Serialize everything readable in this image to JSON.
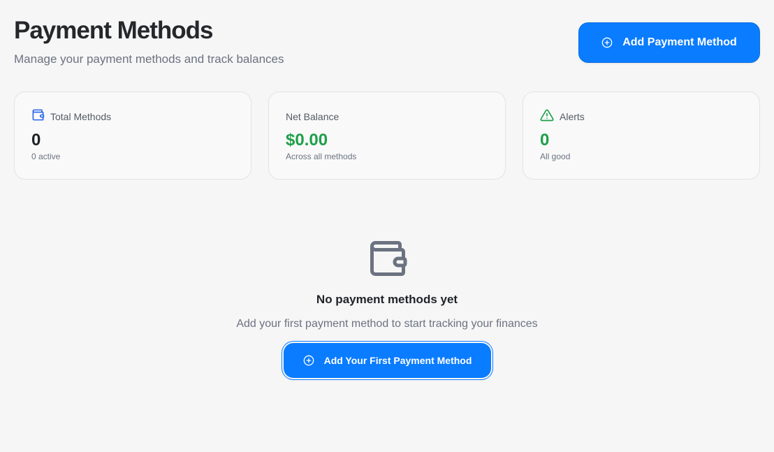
{
  "header": {
    "title": "Payment Methods",
    "subtitle": "Manage your payment methods and track balances",
    "add_button_label": "Add Payment Method"
  },
  "stats": [
    {
      "label": "Total Methods",
      "icon": "wallet-icon",
      "value": "0",
      "note": "0 active",
      "value_color": "#1f2227"
    },
    {
      "label": "Net Balance",
      "icon": "",
      "value": "$0.00",
      "note": "Across all methods",
      "value_color": "#1e9f4a"
    },
    {
      "label": "Alerts",
      "icon": "alert-triangle-icon",
      "value": "0",
      "note": "All good",
      "value_color": "#1e9f4a"
    }
  ],
  "empty_state": {
    "icon": "wallet-icon",
    "title": "No payment methods yet",
    "description": "Add your first payment method to start tracking your finances",
    "button_label": "Add Your First Payment Method"
  },
  "colors": {
    "primary": "#0a7cff",
    "success": "#1e9f4a",
    "wallet_icon": "#2563eb",
    "muted_text": "#6b7280",
    "background": "#f6f6f6"
  }
}
